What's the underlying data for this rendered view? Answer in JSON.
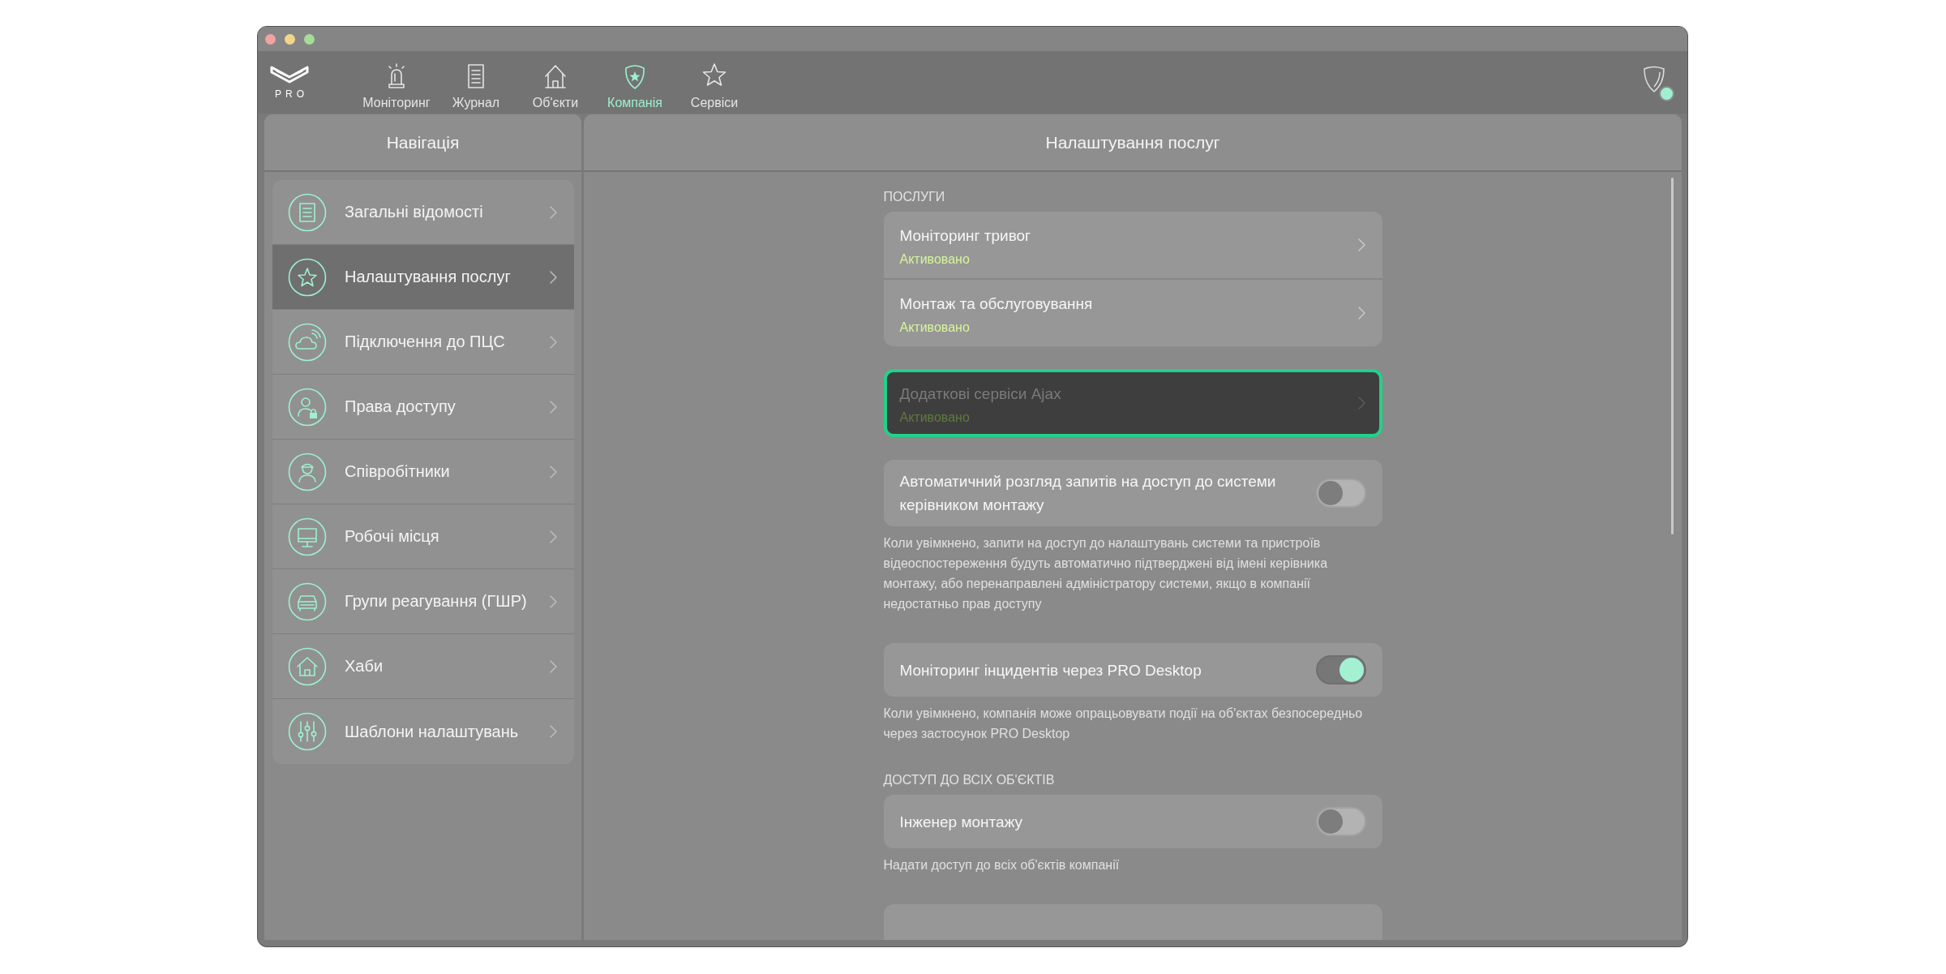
{
  "toolbar": {
    "logo": "PRO",
    "tabs": [
      {
        "label": "Моніторинг",
        "selected": false
      },
      {
        "label": "Журнал",
        "selected": false
      },
      {
        "label": "Об'єкти",
        "selected": false
      },
      {
        "label": "Компанія",
        "selected": true
      },
      {
        "label": "Сервіси",
        "selected": false
      }
    ]
  },
  "sidebar": {
    "title": "Навігація",
    "items": [
      {
        "label": "Загальні відомості",
        "selected": false
      },
      {
        "label": "Налаштування послуг",
        "selected": true
      },
      {
        "label": "Підключення до ПЦС",
        "selected": false
      },
      {
        "label": "Права доступу",
        "selected": false
      },
      {
        "label": "Співробітники",
        "selected": false
      },
      {
        "label": "Робочі місця",
        "selected": false
      },
      {
        "label": "Групи реагування (ГШР)",
        "selected": false
      },
      {
        "label": "Хаби",
        "selected": false
      },
      {
        "label": "Шаблони налаштувань",
        "selected": false
      }
    ]
  },
  "content": {
    "title": "Налаштування послуг",
    "sections": [
      {
        "heading": "ПОСЛУГИ",
        "groups": [
          {
            "focused": false,
            "rows": [
              {
                "kind": "link",
                "title": "Моніторинг тривог",
                "status": "Активовано"
              },
              {
                "kind": "link",
                "title": "Монтаж та обслуговування",
                "status": "Активовано"
              }
            ]
          },
          {
            "focused": true,
            "rows": [
              {
                "kind": "link",
                "title": "Додаткові сервіси Ajax",
                "status": "Активовано"
              }
            ]
          },
          {
            "focused": false,
            "rows": [
              {
                "kind": "toggle",
                "title": "Автоматичний розгляд запитів на доступ до системи керівником монтажу",
                "on": false
              }
            ],
            "note": "Коли увімкнено, запити на доступ до налаштувань системи та пристроїв відеоспостереження будуть автоматично підтверджені від імені керівника монтажу, або перенаправлені адміністратору системи, якщо в компанії недостатньо прав доступу"
          },
          {
            "focused": false,
            "rows": [
              {
                "kind": "toggle",
                "title": "Моніторинг інцидентів через PRO Desktop",
                "on": true
              }
            ],
            "note": "Коли увімкнено, компанія може опрацьовувати події на об'єктах безпосередньо через застосунок PRO Desktop"
          }
        ]
      },
      {
        "heading": "ДОСТУП ДО ВСІХ ОБ'ЄКТІВ",
        "groups": [
          {
            "focused": false,
            "rows": [
              {
                "kind": "toggle",
                "title": "Інженер монтажу",
                "on": false
              }
            ],
            "note": "Надати доступ до всіх об'єктів компанії"
          }
        ]
      }
    ]
  }
}
